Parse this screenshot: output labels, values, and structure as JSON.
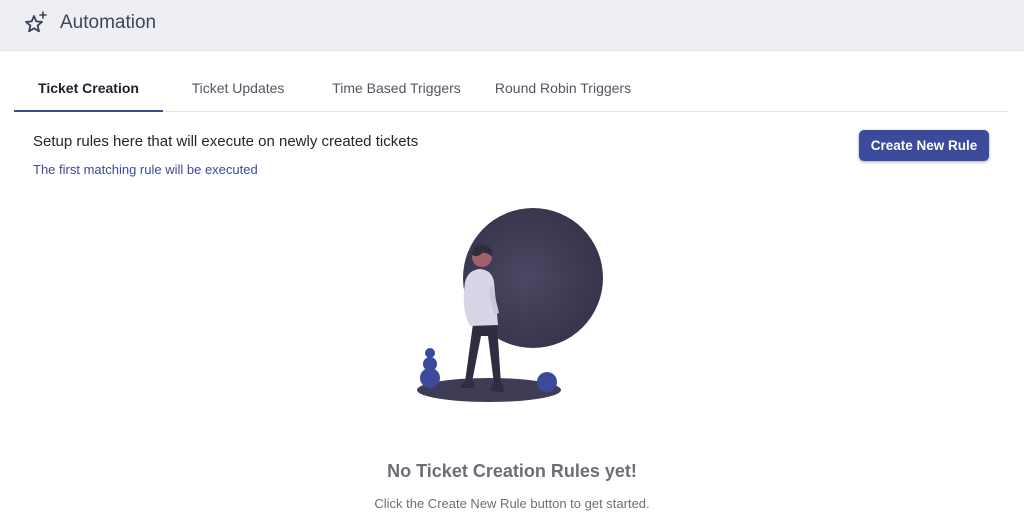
{
  "header": {
    "title": "Automation",
    "icon": "star-sparkle-icon"
  },
  "tabs": [
    {
      "label": "Ticket Creation",
      "active": true
    },
    {
      "label": "Ticket Updates",
      "active": false
    },
    {
      "label": "Time Based Triggers",
      "active": false
    },
    {
      "label": "Round Robin Triggers",
      "active": false
    }
  ],
  "main": {
    "description": "Setup rules here that will execute on newly created tickets",
    "subdescription": "The first matching rule will be executed",
    "create_button_label": "Create New Rule"
  },
  "empty_state": {
    "title": "No Ticket Creation Rules yet!",
    "subtitle": "Click the Create New Rule button to get started.",
    "illustration": "person-with-moon-illustration"
  },
  "colors": {
    "accent": "#3b4a9a",
    "header_bg": "#eeeff3",
    "moon": "#3f3d56"
  }
}
